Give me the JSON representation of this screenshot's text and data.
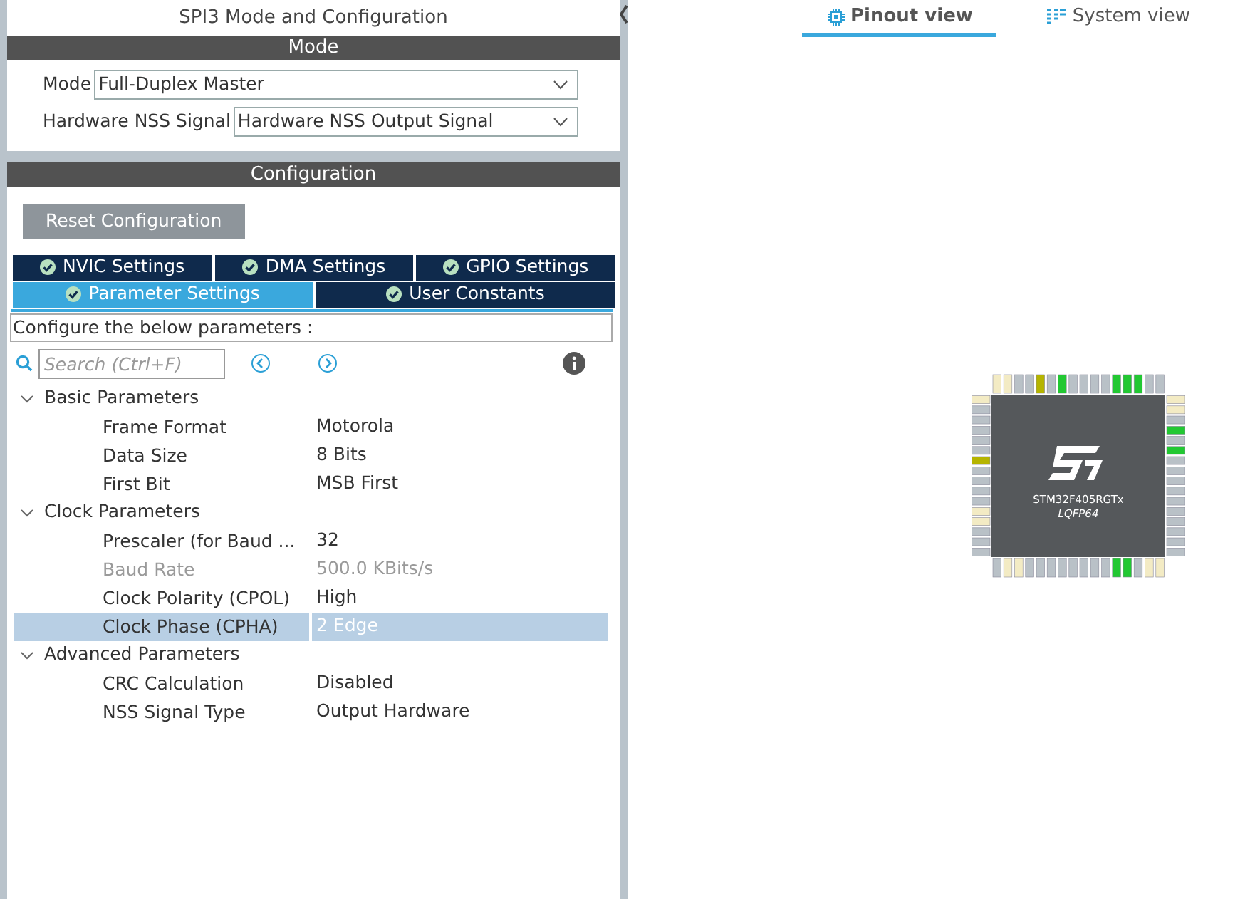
{
  "panel_title": "SPI3 Mode and Configuration",
  "mode_section": {
    "header": "Mode",
    "fields": [
      {
        "label": "Mode",
        "value": "Full-Duplex Master"
      },
      {
        "label": "Hardware NSS Signal",
        "value": "Hardware NSS Output Signal"
      }
    ]
  },
  "config_section": {
    "header": "Configuration",
    "reset_button": "Reset Configuration",
    "tab_rows": [
      [
        {
          "label": "NVIC Settings",
          "selected": false
        },
        {
          "label": "DMA Settings",
          "selected": false
        },
        {
          "label": "GPIO Settings",
          "selected": false
        }
      ],
      [
        {
          "label": "Parameter Settings",
          "selected": true
        },
        {
          "label": "User Constants",
          "selected": false
        }
      ]
    ],
    "description": "Configure the below parameters :",
    "search": {
      "placeholder": "Search (Ctrl+F)"
    },
    "tree": [
      {
        "label": "Basic Parameters",
        "expanded": true,
        "children": [
          {
            "name": "Frame Format",
            "value": "Motorola",
            "selected": false,
            "disabled": false
          },
          {
            "name": "Data Size",
            "value": "8 Bits",
            "selected": false,
            "disabled": false
          },
          {
            "name": "First Bit",
            "value": "MSB First",
            "selected": false,
            "disabled": false
          }
        ]
      },
      {
        "label": "Clock Parameters",
        "expanded": true,
        "children": [
          {
            "name": "Prescaler (for Baud ...",
            "value": "32",
            "selected": false,
            "disabled": false
          },
          {
            "name": "Baud Rate",
            "value": "500.0 KBits/s",
            "selected": false,
            "disabled": true
          },
          {
            "name": "Clock Polarity (CPOL)",
            "value": "High",
            "selected": false,
            "disabled": false
          },
          {
            "name": "Clock Phase (CPHA)",
            "value": "2 Edge",
            "selected": true,
            "disabled": false
          }
        ]
      },
      {
        "label": "Advanced Parameters",
        "expanded": true,
        "children": [
          {
            "name": "CRC Calculation",
            "value": "Disabled",
            "selected": false,
            "disabled": false
          },
          {
            "name": "NSS Signal Type",
            "value": "Output Hardware",
            "selected": false,
            "disabled": false
          }
        ]
      }
    ]
  },
  "view_tabs": [
    {
      "label": "Pinout view",
      "selected": true,
      "kind": "chip"
    },
    {
      "label": "System view",
      "selected": false,
      "kind": "grid"
    }
  ],
  "chip": {
    "part": "STM32F405RGTx",
    "package": "LQFP64",
    "pins": {
      "top": [
        {
          "color": "#f3ebc4"
        },
        {
          "color": "#f3ebc4"
        },
        {
          "color": "#b9c1c7"
        },
        {
          "color": "#b9c1c7"
        },
        {
          "color": "#b5b400"
        },
        {
          "color": "#b9c1c7"
        },
        {
          "color": "#22c832"
        },
        {
          "color": "#b9c1c7"
        },
        {
          "color": "#b9c1c7"
        },
        {
          "color": "#b9c1c7"
        },
        {
          "color": "#b9c1c7"
        },
        {
          "color": "#22c832"
        },
        {
          "color": "#22c832"
        },
        {
          "color": "#22c832"
        },
        {
          "color": "#b9c1c7"
        },
        {
          "color": "#b9c1c7"
        }
      ],
      "right": [
        {
          "color": "#f3ebc4"
        },
        {
          "color": "#f3ebc4"
        },
        {
          "color": "#b9c1c7"
        },
        {
          "color": "#22c832"
        },
        {
          "color": "#b9c1c7"
        },
        {
          "color": "#22c832"
        },
        {
          "color": "#b9c1c7"
        },
        {
          "color": "#b9c1c7"
        },
        {
          "color": "#b9c1c7"
        },
        {
          "color": "#b9c1c7"
        },
        {
          "color": "#b9c1c7"
        },
        {
          "color": "#b9c1c7"
        },
        {
          "color": "#b9c1c7"
        },
        {
          "color": "#b9c1c7"
        },
        {
          "color": "#b9c1c7"
        },
        {
          "color": "#b9c1c7"
        }
      ],
      "bottom": [
        {
          "color": "#b9c1c7"
        },
        {
          "color": "#f3ebc4"
        },
        {
          "color": "#f3ebc4"
        },
        {
          "color": "#b9c1c7"
        },
        {
          "color": "#b9c1c7"
        },
        {
          "color": "#b9c1c7"
        },
        {
          "color": "#b9c1c7"
        },
        {
          "color": "#b9c1c7"
        },
        {
          "color": "#b9c1c7"
        },
        {
          "color": "#b9c1c7"
        },
        {
          "color": "#b9c1c7"
        },
        {
          "color": "#22c832"
        },
        {
          "color": "#22c832"
        },
        {
          "color": "#b9c1c7"
        },
        {
          "color": "#f3ebc4"
        },
        {
          "color": "#f3ebc4"
        }
      ],
      "left": [
        {
          "color": "#f3ebc4"
        },
        {
          "color": "#b9c1c7"
        },
        {
          "color": "#b9c1c7"
        },
        {
          "color": "#b9c1c7"
        },
        {
          "color": "#b9c1c7"
        },
        {
          "color": "#b9c1c7"
        },
        {
          "color": "#b5b400"
        },
        {
          "color": "#b9c1c7"
        },
        {
          "color": "#b9c1c7"
        },
        {
          "color": "#b9c1c7"
        },
        {
          "color": "#b9c1c7"
        },
        {
          "color": "#f3ebc4"
        },
        {
          "color": "#f3ebc4"
        },
        {
          "color": "#b9c1c7"
        },
        {
          "color": "#b9c1c7"
        },
        {
          "color": "#b9c1c7"
        }
      ]
    }
  }
}
